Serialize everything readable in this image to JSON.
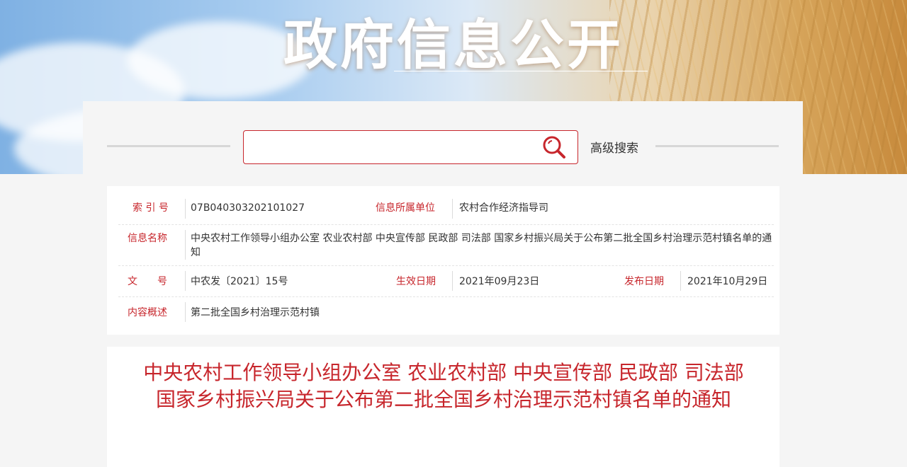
{
  "banner": {
    "title": "政府信息公开"
  },
  "search": {
    "value": "",
    "placeholder": "",
    "advanced_label": "高级搜索"
  },
  "info": {
    "index_label": "索 引 号",
    "index_value": "07B040303202101027",
    "unit_label": "信息所属单位",
    "unit_value": "农村合作经济指导司",
    "name_label": "信息名称",
    "name_value": "中央农村工作领导小组办公室 农业农村部 中央宣传部 民政部 司法部 国家乡村振兴局关于公布第二批全国乡村治理示范村镇名单的通知",
    "docno_label": "文　　号",
    "docno_value": "中农发〔2021〕15号",
    "effective_label": "生效日期",
    "effective_value": "2021年09月23日",
    "publish_label": "发布日期",
    "publish_value": "2021年10月29日",
    "summary_label": "内容概述",
    "summary_value": "第二批全国乡村治理示范村镇"
  },
  "article": {
    "title": "中央农村工作领导小组办公室 农业农村部 中央宣传部 民政部 司法部 国家乡村振兴局关于公布第二批全国乡村治理示范村镇名单的通知"
  },
  "colors": {
    "accent": "#c7262c",
    "text": "#333333",
    "background": "#f5f5f5"
  }
}
